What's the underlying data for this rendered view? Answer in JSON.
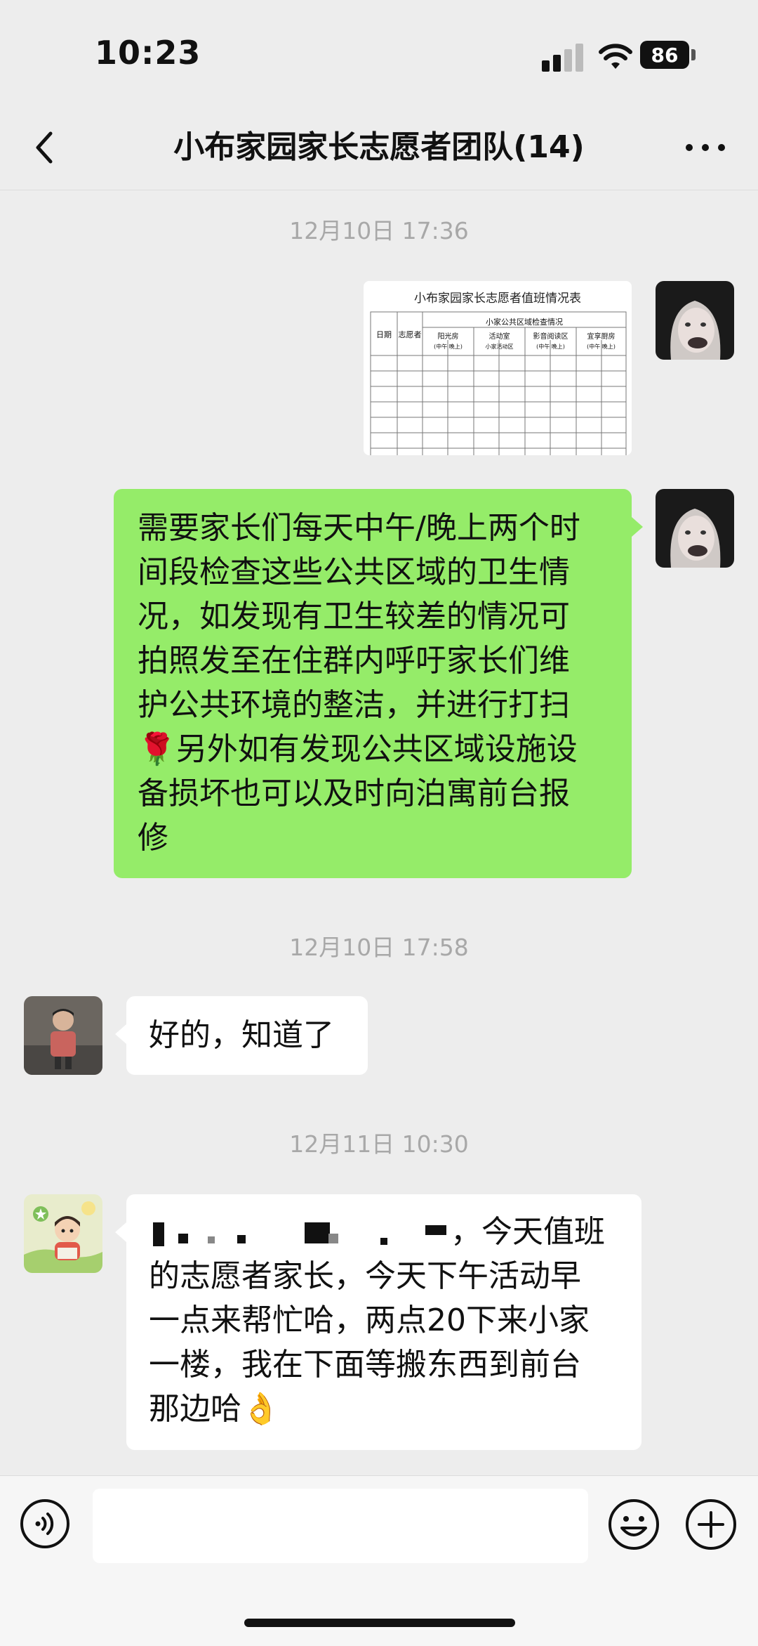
{
  "status_bar": {
    "time": "10:23",
    "battery": "86"
  },
  "nav": {
    "title": "小布家园家长志愿者团队(14)"
  },
  "messages": {
    "ts1": "12月10日 17:36",
    "attachment": {
      "title": "小布家园家长志愿者值班情况表",
      "col_date": "日期",
      "col_volunteer": "志愿者",
      "group_header": "小家公共区域检查情况",
      "areas": [
        "阳光房",
        "活动室",
        "影音阅读区",
        "宜享厨房"
      ],
      "sub_noon_night": "(中午  晚上)",
      "sub_activity": "小家活动区"
    },
    "msg1_lines": [
      "需要家长们每天中午/晚上两个时",
      "间段检查这些公共区域的卫生情",
      "况，如发现有卫生较差的情况可",
      "拍照发至在住群内呼吁家长们维",
      "护公共环境的整洁，并进行打扫",
      "🌹另外如有发现公共区域设施设",
      "备损坏也可以及时向泊寓前台报",
      "修"
    ],
    "ts2": "12月10日 17:58",
    "msg2": "好的，知道了",
    "ts3": "12月11日 10:30",
    "msg3_line1_tail": "，今天值班",
    "msg3_lines": [
      "的志愿者家长，今天下午活动早",
      "一点来帮忙哈，两点20下来小家",
      "一楼，我在下面等搬东西到前台",
      "那边哈👌"
    ]
  },
  "icons": {
    "back": "back-chevron-icon",
    "more": "more-dots-icon",
    "voice": "voice-input-icon",
    "emoji": "emoji-icon",
    "plus": "plus-icon"
  },
  "colors": {
    "sent_bubble": "#95ec69",
    "received_bubble": "#ffffff",
    "background": "#ededed"
  }
}
